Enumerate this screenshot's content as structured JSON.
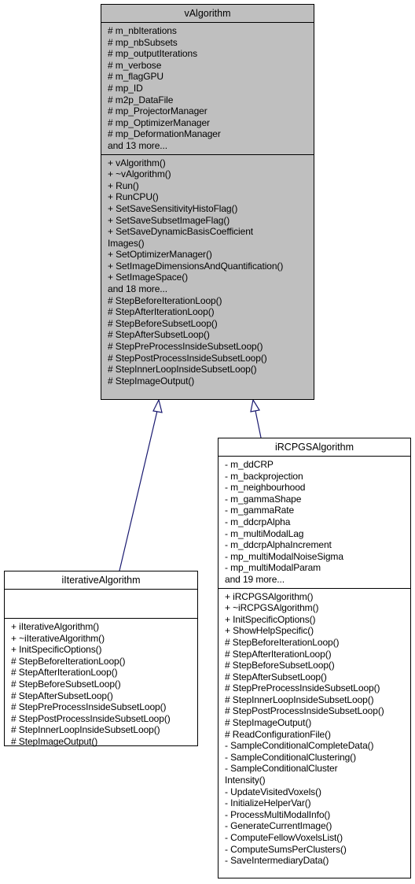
{
  "classes": {
    "vAlgorithm": {
      "name": "vAlgorithm",
      "attributes": [
        "# m_nbIterations",
        "# mp_nbSubsets",
        "# mp_outputIterations",
        "# m_verbose",
        "# m_flagGPU",
        "# mp_ID",
        "# m2p_DataFile",
        "# mp_ProjectorManager",
        "# mp_OptimizerManager",
        "# mp_DeformationManager",
        "and 13 more..."
      ],
      "methods": [
        "+ vAlgorithm()",
        "+ ~vAlgorithm()",
        "+ Run()",
        "+ RunCPU()",
        "+ SetSaveSensitivityHistoFlag()",
        "+ SetSaveSubsetImageFlag()",
        "+ SetSaveDynamicBasisCoefficient",
        "Images()",
        "+ SetOptimizerManager()",
        "+ SetImageDimensionsAndQuantification()",
        "+ SetImageSpace()",
        "and 18 more...",
        "# StepBeforeIterationLoop()",
        "# StepAfterIterationLoop()",
        "# StepBeforeSubsetLoop()",
        "# StepAfterSubsetLoop()",
        "# StepPreProcessInsideSubsetLoop()",
        "# StepPostProcessInsideSubsetLoop()",
        "# StepInnerLoopInsideSubsetLoop()",
        "# StepImageOutput()"
      ]
    },
    "iIterativeAlgorithm": {
      "name": "iIterativeAlgorithm",
      "attributes": [],
      "methods": [
        "+ iIterativeAlgorithm()",
        "+ ~iIterativeAlgorithm()",
        "+ InitSpecificOptions()",
        "# StepBeforeIterationLoop()",
        "# StepAfterIterationLoop()",
        "# StepBeforeSubsetLoop()",
        "# StepAfterSubsetLoop()",
        "# StepPreProcessInsideSubsetLoop()",
        "# StepPostProcessInsideSubsetLoop()",
        "# StepInnerLoopInsideSubsetLoop()",
        "# StepImageOutput()"
      ]
    },
    "iRCPGSAlgorithm": {
      "name": "iRCPGSAlgorithm",
      "attributes": [
        "- m_ddCRP",
        "- m_backprojection",
        "- m_neighbourhood",
        "- m_gammaShape",
        "- m_gammaRate",
        "- m_ddcrpAlpha",
        "- m_multiModalLag",
        "- m_ddcrpAlphaIncrement",
        "- mp_multiModalNoiseSigma",
        "- mp_multiModalParam",
        "and 19 more..."
      ],
      "methods": [
        "+ iRCPGSAlgorithm()",
        "+ ~iRCPGSAlgorithm()",
        "+ InitSpecificOptions()",
        "+ ShowHelpSpecific()",
        "# StepBeforeIterationLoop()",
        "# StepAfterIterationLoop()",
        "# StepBeforeSubsetLoop()",
        "# StepAfterSubsetLoop()",
        "# StepPreProcessInsideSubsetLoop()",
        "# StepInnerLoopInsideSubsetLoop()",
        "# StepPostProcessInsideSubsetLoop()",
        "# StepImageOutput()",
        "# ReadConfigurationFile()",
        "- SampleConditionalCompleteData()",
        "- SampleConditionalClustering()",
        "- SampleConditionalCluster",
        "Intensity()",
        "- UpdateVisitedVoxels()",
        "- InitializeHelperVar()",
        "- ProcessMultiModalInfo()",
        "- GenerateCurrentImage()",
        "- ComputeFellowVoxelsList()",
        "- ComputeSumsPerClusters()",
        "- SaveIntermediaryData()"
      ]
    }
  },
  "edges": [
    {
      "from": "iIterativeAlgorithm",
      "to": "vAlgorithm",
      "type": "inheritance"
    },
    {
      "from": "iRCPGSAlgorithm",
      "to": "vAlgorithm",
      "type": "inheritance"
    }
  ],
  "colors": {
    "edge": "#191970",
    "base_fill": "#bfbfbf",
    "box_fill": "#ffffff"
  }
}
